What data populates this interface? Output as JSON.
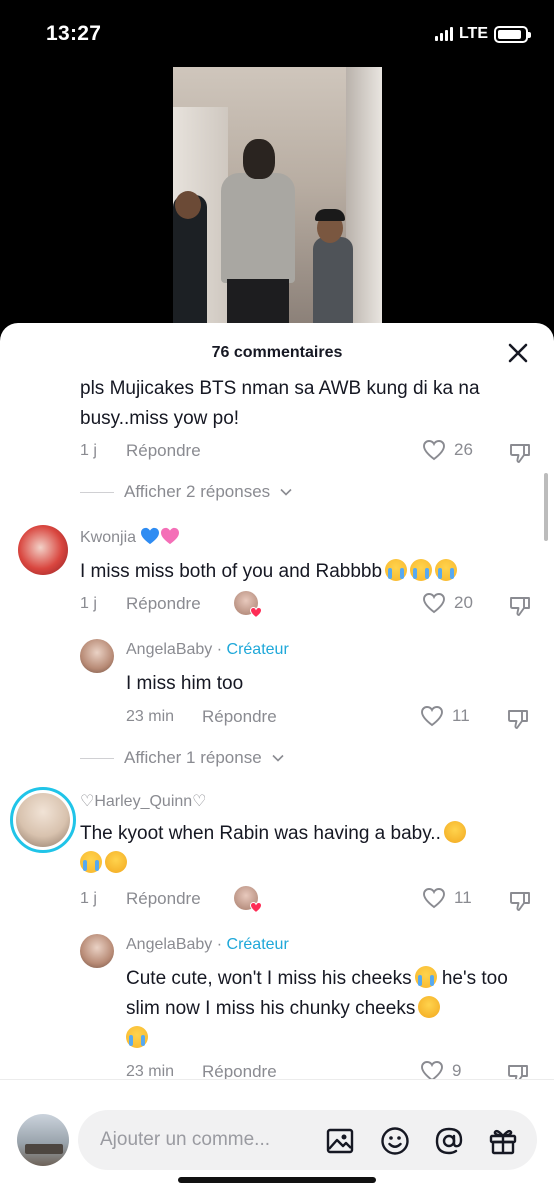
{
  "status_bar": {
    "time": "13:27",
    "network": "LTE",
    "battery_level": 0.9
  },
  "sheet": {
    "title": "76 commentaires"
  },
  "comments": [
    {
      "text": "pls Mujicakes BTS nman sa AWB kung di ka na busy..miss yow po!",
      "time": "1 j",
      "reply_label": "Répondre",
      "likes": "26",
      "view_replies": "Afficher 2 réponses"
    },
    {
      "username": "Kwonjia",
      "username_emojis": [
        "blue-heart",
        "pink-heart"
      ],
      "text": "I miss miss both of you and Rabbbb",
      "text_emojis": [
        "cry",
        "cry",
        "cry"
      ],
      "time": "1 j",
      "reply_label": "Répondre",
      "likes": "20",
      "reply": {
        "username": "AngelaBaby",
        "separator": " · ",
        "badge": "Créateur",
        "text": "I miss him too",
        "time": "23 min",
        "reply_label": "Répondre",
        "likes": "11"
      },
      "view_replies": "Afficher 1 réponse"
    },
    {
      "username": "♡Harley_Quinn♡",
      "text": "The kyoot when Rabin was having a baby..",
      "text_emojis": [
        "grin",
        "cry",
        "love"
      ],
      "time": "1 j",
      "reply_label": "Répondre",
      "likes": "11",
      "reply": {
        "username": "AngelaBaby",
        "separator": " · ",
        "badge": "Créateur",
        "text_1": "Cute cute, won't I miss his cheeks",
        "text_2": " he's too slim now I miss his chunky cheeks",
        "text_emojis": [
          "cry",
          "relieved",
          "cry"
        ],
        "time": "23 min",
        "reply_label": "Répondre",
        "likes": "9"
      }
    }
  ],
  "input_bar": {
    "placeholder": "Ajouter un comme..."
  },
  "icons": {
    "close": "close-icon",
    "like": "heart-outline-icon",
    "dislike": "thumbs-down-icon",
    "chevron": "chevron-down-icon",
    "image": "image-icon",
    "emoji": "emoji-icon",
    "mention": "at-icon",
    "gift": "gift-icon"
  },
  "colors": {
    "accent_creator": "#1fa8d9",
    "muted_text": "#8a8b91",
    "text": "#161823"
  }
}
